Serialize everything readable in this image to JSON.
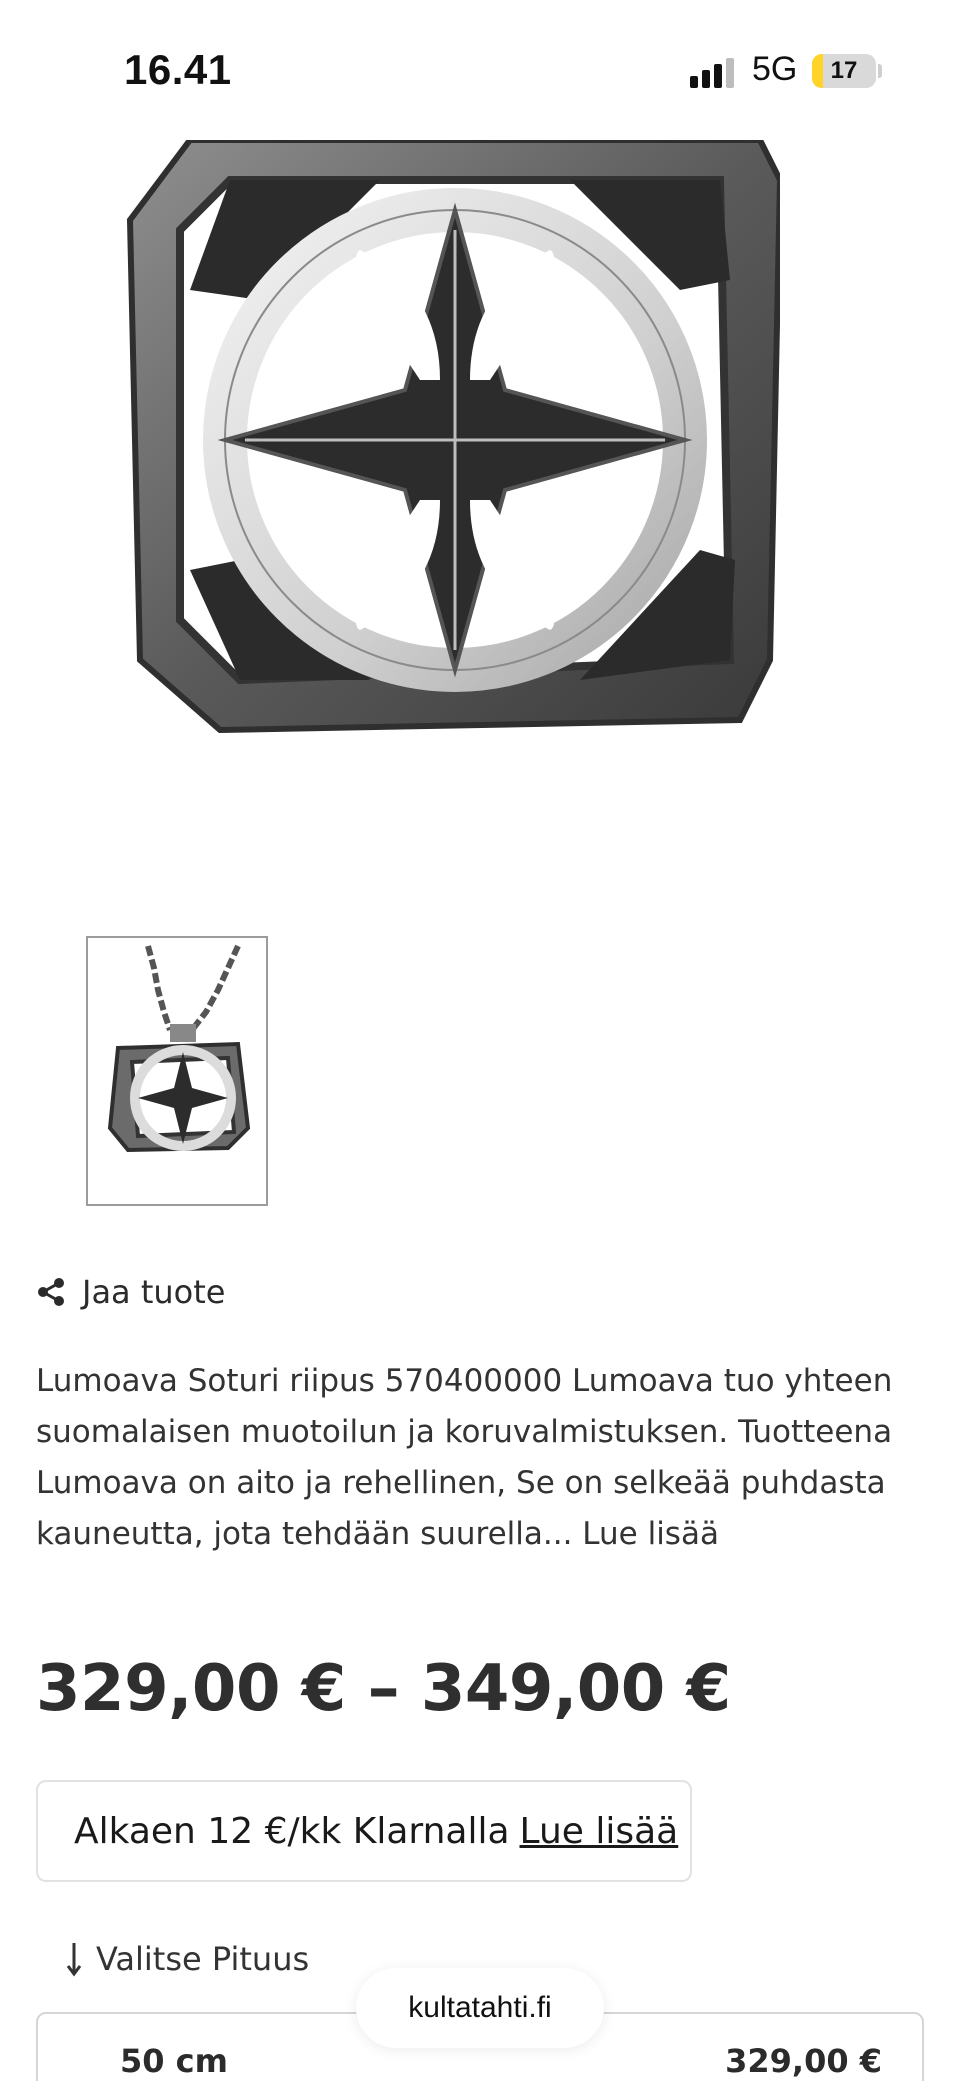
{
  "status_bar": {
    "time": "16.41",
    "network": "5G",
    "battery": "17",
    "battery_level": 0.17,
    "battery_color": "#ffd426"
  },
  "product": {
    "image_icon": "pendant-image",
    "thumbnail_icon": "pendant-thumbnail",
    "share_label": "Jaa tuote",
    "description": "Lumoava Soturi riipus 570400000 Lumoava tuo yhteen suomalaisen muotoilun ja koruvalmistuksen. Tuotteena Lumoava on aito ja rehellinen, Se on selkeää puhdasta kauneutta, jota tehdään suurella... Lue lisää",
    "price_range": "329,00 € – 349,00 €"
  },
  "klarna": {
    "text": "Alkaen 12 €/kk Klarnalla",
    "link": "Lue lisää"
  },
  "variant_select": {
    "label": "Valitse Pituus",
    "options": [
      {
        "name": "50 cm",
        "price": "329,00 €"
      }
    ]
  },
  "browser": {
    "domain": "kultatahti.fi"
  }
}
